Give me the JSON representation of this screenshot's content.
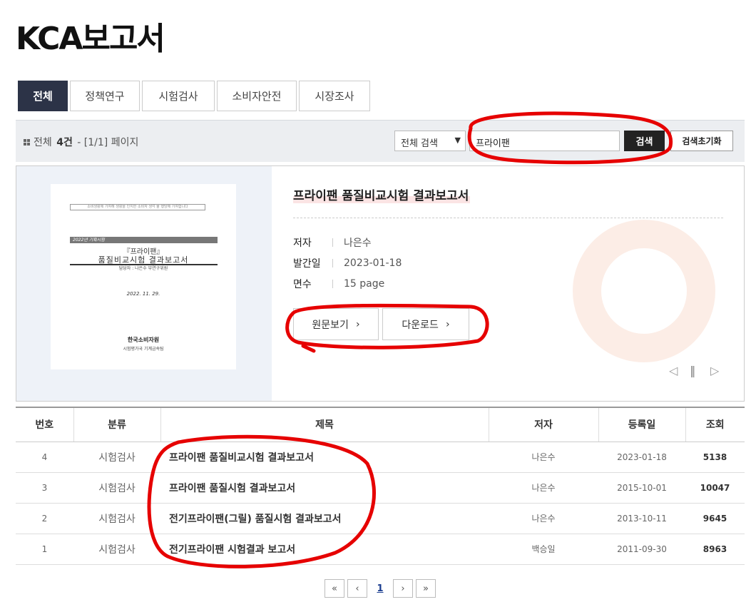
{
  "page": {
    "title": "KCA보고서"
  },
  "tabs": [
    {
      "label": "전체",
      "active": true
    },
    {
      "label": "정책연구"
    },
    {
      "label": "시험검사"
    },
    {
      "label": "소비자안전"
    },
    {
      "label": "시장조사"
    }
  ],
  "search": {
    "count_prefix": "전체",
    "count_value": "4건",
    "page_info": "- [1/1] 페이지",
    "select_value": "전체 검색",
    "query": "프라이팬",
    "search_label": "검색",
    "reset_label": "검색초기화"
  },
  "featured": {
    "title": "프라이팬 품질비교시험 결과보고서",
    "author_label": "저자",
    "author": "나은수",
    "date_label": "발간일",
    "date": "2023-01-18",
    "pages_label": "면수",
    "pages": "15 page",
    "view_label": "원문보기",
    "download_label": "다운로드",
    "cover": {
      "line1": "소비생활에 기여해 생활을 인지한 소비자 생각 물 행당해 기여합니다",
      "line2": "2022년 기획시험",
      "line3": "『프라이팬』",
      "line4": "품질비교시험 결과보고서",
      "line5": "담당자 : 나은수 부연구위원",
      "line6": "2022. 11. 29.",
      "line7": "한국소비자원",
      "line8": "시험평가국 기계금속팀"
    }
  },
  "table": {
    "headers": [
      "번호",
      "분류",
      "제목",
      "저자",
      "등록일",
      "조회"
    ],
    "rows": [
      {
        "no": "4",
        "category": "시험검사",
        "title": "프라이팬 품질비교시험 결과보고서",
        "author": "나은수",
        "date": "2023-01-18",
        "views": "5138"
      },
      {
        "no": "3",
        "category": "시험검사",
        "title": "프라이팬 품질시험 결과보고서",
        "author": "나은수",
        "date": "2015-10-01",
        "views": "10047"
      },
      {
        "no": "2",
        "category": "시험검사",
        "title": "전기프라이팬(그릴) 품질시험 결과보고서",
        "author": "나은수",
        "date": "2013-10-11",
        "views": "9645"
      },
      {
        "no": "1",
        "category": "시험검사",
        "title": "전기프라이팬 시험결과 보고서",
        "author": "백승일",
        "date": "2011-09-30",
        "views": "8963"
      }
    ]
  },
  "pager": {
    "current": "1"
  },
  "colors": {
    "tab_active": "#2c3347",
    "annotation": "#e60000",
    "deco": "#f4a58a"
  }
}
